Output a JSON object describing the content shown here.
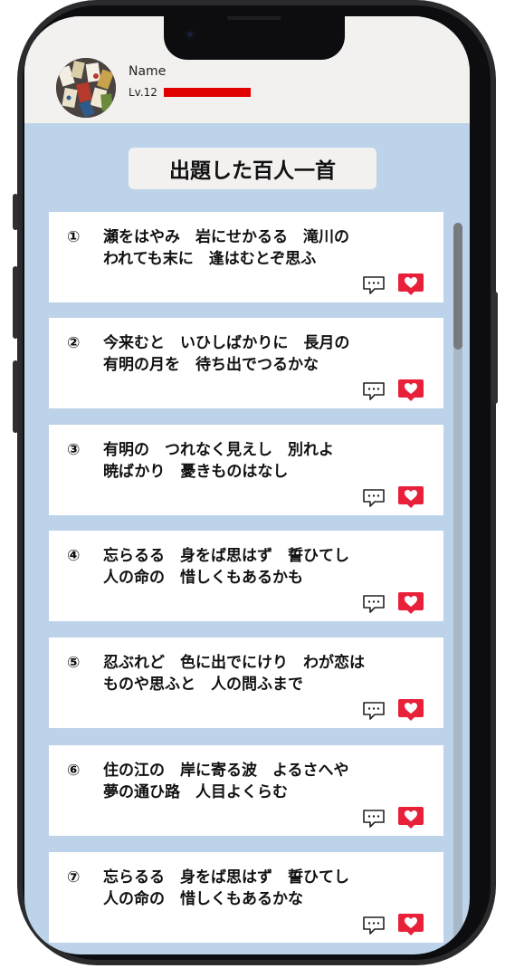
{
  "profile": {
    "name": "Name",
    "level": "Lv.12",
    "level_progress": 1.0,
    "level_bar_color": "#e00000"
  },
  "screen_title": "出題した百人一首",
  "poems": [
    {
      "num": "①",
      "line1": "瀬をはやみ　岩にせかるる　滝川の",
      "line2": "われても末に　逢はむとぞ思ふ"
    },
    {
      "num": "②",
      "line1": "今来むと　いひしばかりに　長月の",
      "line2": "有明の月を　待ち出でつるかな"
    },
    {
      "num": "③",
      "line1": "有明の　つれなく見えし　別れよ",
      "line2": "暁ばかり　憂きものはなし"
    },
    {
      "num": "④",
      "line1": "忘らるる　身をば思はず　誓ひてし",
      "line2": "人の命の　惜しくもあるかも"
    },
    {
      "num": "⑤",
      "line1": "忍ぶれど　色に出でにけり　わが恋は",
      "line2": "ものや思ふと　人の問ふまで"
    },
    {
      "num": "⑥",
      "line1": "住の江の　岸に寄る波　よるさへや",
      "line2": "夢の通ひ路　人目よくらむ"
    },
    {
      "num": "⑦",
      "line1": "忘らるる　身をば思はず　誓ひてし",
      "line2": "人の命の　惜しくもあるかな"
    }
  ],
  "icons": {
    "comment": "comment-icon",
    "like": "heart-icon"
  },
  "colors": {
    "like": "#e8203a",
    "background": "#bcd3ea"
  }
}
